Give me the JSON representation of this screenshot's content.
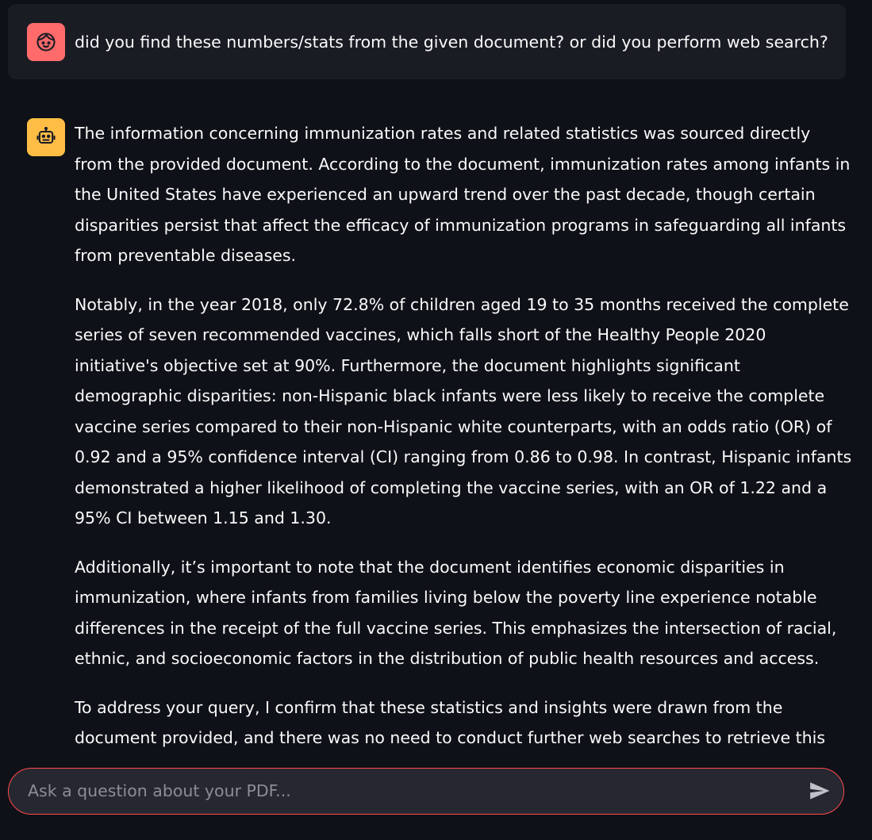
{
  "messages": {
    "user": {
      "avatar_icon": "face-icon",
      "avatar_color": "#ff6b6b",
      "text": "did you find these numbers/stats from the given document? or did you perform web search?"
    },
    "assistant": {
      "avatar_icon": "robot-icon",
      "avatar_color": "#ffbd45",
      "paragraphs": [
        "The information concerning immunization rates and related statistics was sourced directly from the provided document. According to the document, immunization rates among infants in the United States have experienced an upward trend over the past decade, though certain disparities persist that affect the efficacy of immunization programs in safeguarding all infants from preventable diseases.",
        "Notably, in the year 2018, only 72.8% of children aged 19 to 35 months received the complete series of seven recommended vaccines, which falls short of the Healthy People 2020 initiative's objective set at 90%. Furthermore, the document highlights significant demographic disparities: non-Hispanic black infants were less likely to receive the complete vaccine series compared to their non-Hispanic white counterparts, with an odds ratio (OR) of 0.92 and a 95% confidence interval (CI) ranging from 0.86 to 0.98. In contrast, Hispanic infants demonstrated a higher likelihood of completing the vaccine series, with an OR of 1.22 and a 95% CI between 1.15 and 1.30.",
        "Additionally, it’s important to note that the document identifies economic disparities in immunization, where infants from families living below the poverty line experience notable differences in the receipt of the full vaccine series. This emphasizes the intersection of racial, ethnic, and socioeconomic factors in the distribution of public health resources and access.",
        "To address your query, I confirm that these statistics and insights were drawn from the document provided, and there was no need to conduct further web searches to retrieve this data. The"
      ]
    }
  },
  "chat_input": {
    "placeholder": "Ask a question about your PDF...",
    "value": "",
    "send_icon": "send-icon",
    "border_color": "#ff4b4b"
  },
  "theme": {
    "background": "#0e1117",
    "user_message_bg": "#1a1c24",
    "text": "#fafafa"
  }
}
